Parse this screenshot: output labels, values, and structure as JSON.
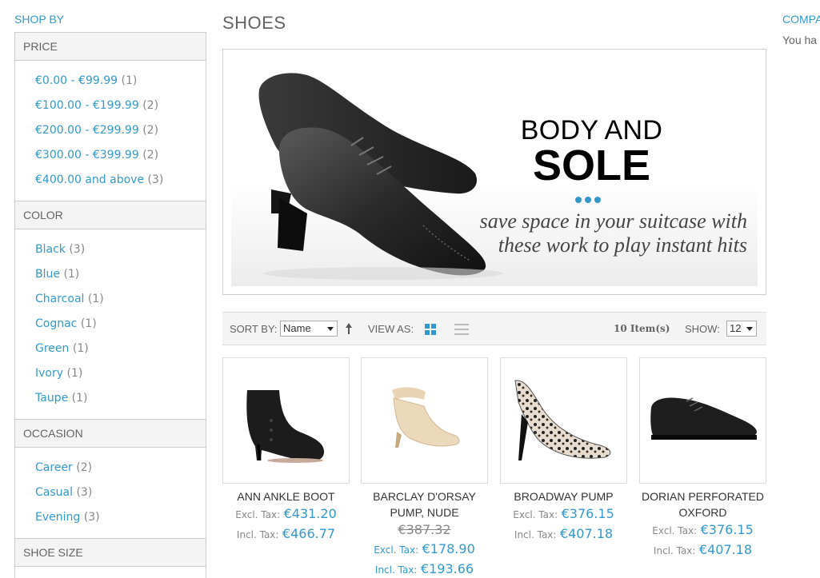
{
  "sidebar": {
    "title": "SHOP BY",
    "facets": [
      {
        "heading": "PRICE",
        "items": [
          {
            "label": "€0.00 - €99.99",
            "count": "(1)"
          },
          {
            "label": "€100.00 - €199.99",
            "count": "(2)"
          },
          {
            "label": "€200.00 - €299.99",
            "count": "(2)"
          },
          {
            "label": "€300.00 - €399.99",
            "count": "(2)"
          },
          {
            "label": "€400.00 and above",
            "count": "(3)"
          }
        ]
      },
      {
        "heading": "COLOR",
        "items": [
          {
            "label": "Black",
            "count": "(3)"
          },
          {
            "label": "Blue",
            "count": "(1)"
          },
          {
            "label": "Charcoal",
            "count": "(1)"
          },
          {
            "label": "Cognac",
            "count": "(1)"
          },
          {
            "label": "Green",
            "count": "(1)"
          },
          {
            "label": "Ivory",
            "count": "(1)"
          },
          {
            "label": "Taupe",
            "count": "(1)"
          }
        ]
      },
      {
        "heading": "OCCASION",
        "items": [
          {
            "label": "Career",
            "count": "(2)"
          },
          {
            "label": "Casual",
            "count": "(3)"
          },
          {
            "label": "Evening",
            "count": "(3)"
          }
        ]
      },
      {
        "heading": "SHOE SIZE",
        "items": []
      }
    ]
  },
  "main": {
    "title": "SHOES",
    "banner": {
      "line1": "BODY AND",
      "line2": "SOLE",
      "tagline1": "save space in your suitcase with",
      "tagline2": "these work to play instant hits",
      "accent": "#3399cc"
    },
    "toolbar": {
      "sort_label": "SORT BY:",
      "sort_value": "Name",
      "view_label": "VIEW AS:",
      "item_count": "10 Item(s)",
      "show_label": "SHOW:",
      "show_value": "12",
      "icons": [
        "sort-ascending-icon",
        "grid-view-icon",
        "list-view-icon"
      ]
    },
    "products": [
      {
        "name": "ANN ANKLE BOOT",
        "excl_label": "Excl. Tax:",
        "excl": "€431.20",
        "incl_label": "Incl. Tax:",
        "incl": "€466.77"
      },
      {
        "name": "BARCLAY D'ORSAY PUMP, NUDE",
        "old_price": "€387.32",
        "excl_label": "Excl. Tax:",
        "excl": "€178.90",
        "incl_label": "Incl. Tax:",
        "incl": "€193.66"
      },
      {
        "name": "BROADWAY PUMP",
        "excl_label": "Excl. Tax:",
        "excl": "€376.15",
        "incl_label": "Incl. Tax:",
        "incl": "€407.18"
      },
      {
        "name": "DORIAN PERFORATED OXFORD",
        "excl_label": "Excl. Tax:",
        "excl": "€376.15",
        "incl_label": "Incl. Tax:",
        "incl": "€407.18"
      }
    ]
  },
  "compare": {
    "title": "COMPA",
    "text": "You ha"
  }
}
